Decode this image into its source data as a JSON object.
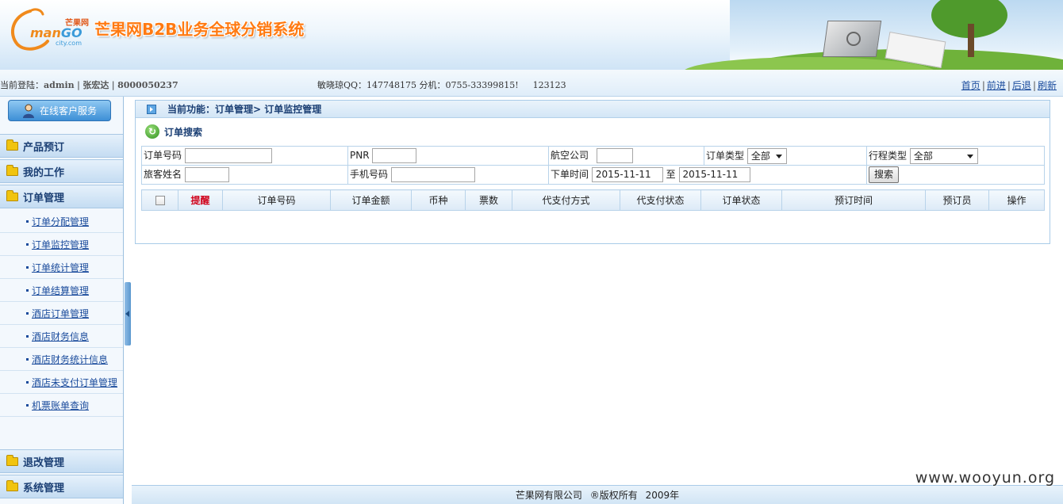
{
  "header": {
    "logo": {
      "cn": "芒果网",
      "en_a": "man",
      "en_b": "GO",
      "domain": "city.com"
    },
    "site_title": "芒果网B2B业务全球分销系统"
  },
  "infobar": {
    "login_label": "当前登陆：",
    "user": "admin",
    "sep": "|",
    "name": "张宏达",
    "account": "8000050237",
    "qq": "​​敏晓琼QQ：147748175 分机：0755-33399815!",
    "code": "123123",
    "nav": [
      "首页",
      "前进",
      "后退",
      "刷新"
    ]
  },
  "sidebar": {
    "cs_button": "在线客户服务",
    "menus": [
      "产品预订",
      "我的工作",
      "订单管理"
    ],
    "sub_items": [
      "订单分配管理",
      "订单监控管理",
      "订单统计管理",
      "订单结算管理",
      "酒店订单管理",
      "酒店财务信息",
      "酒店财务统计信息",
      "酒店未支付订单管理",
      "机票账单查询"
    ],
    "bottom_menus": [
      "退改管理",
      "系统管理"
    ]
  },
  "main": {
    "current_function": "当前功能：订单管理> 订单监控管理",
    "search_title": "订单搜索",
    "labels": {
      "order_no": "订单号码",
      "pnr": "PNR",
      "airline": "航空公司",
      "order_type": "订单类型",
      "trip_type": "行程类型",
      "passenger": "旅客姓名",
      "mobile": "手机号码",
      "order_time": "下单时间",
      "to": "至"
    },
    "values": {
      "order_type": "全部",
      "trip_type": "全部",
      "date_from": "2015-11-11",
      "date_to": "2015-11-11"
    },
    "search_button": "搜索",
    "columns": [
      "提醒",
      "订单号码",
      "订单金额",
      "币种",
      "票数",
      "代支付方式",
      "代支付状态",
      "订单状态",
      "预订时间",
      "预订员",
      "操作"
    ]
  },
  "footer": {
    "company": "芒果网有限公司",
    "rights": "®版权所有",
    "year": "2009年"
  },
  "watermark": "www.wooyun.org",
  "colors": {
    "title_orange": "#ff7a12",
    "link_blue": "#1a4b9c",
    "remind_red": "#d0021b"
  }
}
